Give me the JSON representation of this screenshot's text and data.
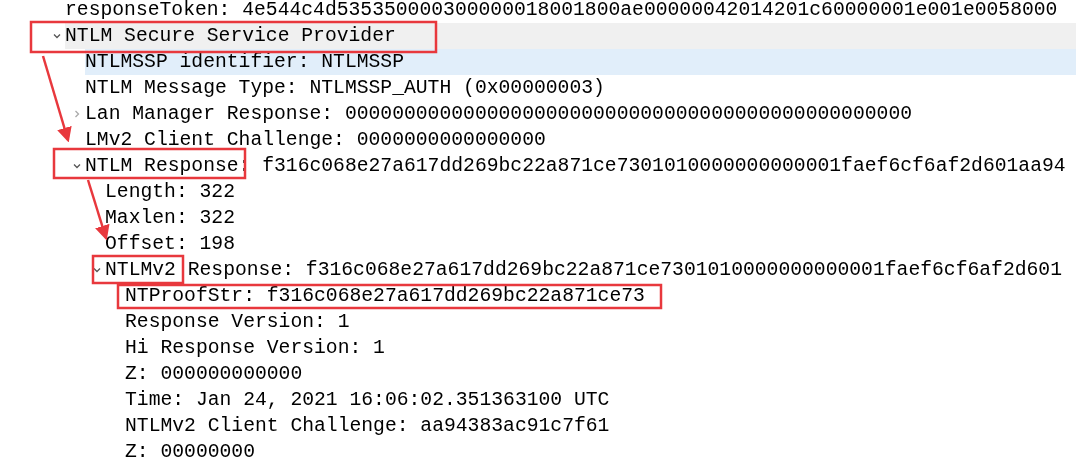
{
  "tree": [
    {
      "text": "responseToken: 4e544c4d535350000300000018001800ae00000042014201c60000001e001e0058000",
      "selected": false,
      "shaded": false
    },
    {
      "text": "NTLM Secure Service Provider",
      "expanded": true,
      "selected": false,
      "shaded": true,
      "children": [
        {
          "text": "NTLMSSP identifier: NTLMSSP",
          "selected": true,
          "shaded": false
        },
        {
          "text": "NTLM Message Type: NTLMSSP_AUTH (0x00000003)",
          "selected": false,
          "shaded": false
        },
        {
          "text": "Lan Manager Response: 000000000000000000000000000000000000000000000000",
          "expanded": false,
          "selected": false,
          "shaded": false
        },
        {
          "text": "LMv2 Client Challenge: 0000000000000000",
          "selected": false,
          "shaded": false
        },
        {
          "text": "NTLM Response: f316c068e27a617dd269bc22a871ce7301010000000000001faef6cf6af2d601aa94",
          "expanded": true,
          "selected": false,
          "shaded": false,
          "children": [
            {
              "text": "Length: 322",
              "selected": false,
              "shaded": false
            },
            {
              "text": "Maxlen: 322",
              "selected": false,
              "shaded": false
            },
            {
              "text": "Offset: 198",
              "selected": false,
              "shaded": false
            },
            {
              "text": "NTLMv2 Response: f316c068e27a617dd269bc22a871ce7301010000000000001faef6cf6af2d601",
              "expanded": true,
              "selected": false,
              "shaded": false,
              "children": [
                {
                  "text": "NTProofStr: f316c068e27a617dd269bc22a871ce73",
                  "selected": false,
                  "shaded": false
                },
                {
                  "text": "Response Version: 1",
                  "selected": false,
                  "shaded": false
                },
                {
                  "text": "Hi Response Version: 1",
                  "selected": false,
                  "shaded": false
                },
                {
                  "text": "Z: 000000000000",
                  "selected": false,
                  "shaded": false
                },
                {
                  "text": "Time: Jan 24, 2021 16:06:02.351363100 UTC",
                  "selected": false,
                  "shaded": false
                },
                {
                  "text": "NTLMv2 Client Challenge: aa94383ac91c7f61",
                  "selected": false,
                  "shaded": false
                },
                {
                  "text": "Z: 00000000",
                  "selected": false,
                  "shaded": false
                }
              ]
            }
          ]
        }
      ]
    }
  ]
}
